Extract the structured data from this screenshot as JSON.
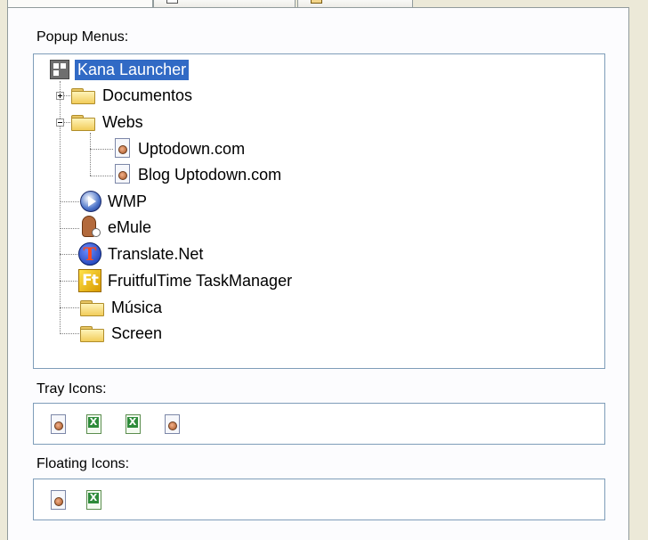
{
  "popup_label": "Popup Menus:",
  "tray_label": "Tray Icons:",
  "floating_label": "Floating Icons:",
  "tree": {
    "root": "Kana Launcher",
    "documentos": "Documentos",
    "webs": "Webs",
    "uptodown": "Uptodown.com",
    "blog": "Blog Uptodown.com",
    "wmp": "WMP",
    "emule": "eMule",
    "translate": "Translate.Net",
    "fruitful": "FruitfulTime TaskManager",
    "musica": "Música",
    "screen": "Screen"
  },
  "icons": {
    "translate_glyph": "T",
    "fruitful_glyph": "Ft",
    "excel_glyph": "X"
  },
  "tray_icons": [
    "link-doc-icon",
    "excel-doc-icon",
    "excel-doc-icon",
    "link-doc-icon"
  ],
  "floating_icons": [
    "link-doc-icon",
    "excel-doc-icon"
  ],
  "colors": {
    "selection": "#316ac5",
    "border": "#7f9db9",
    "window_bg": "#ece9d8"
  }
}
